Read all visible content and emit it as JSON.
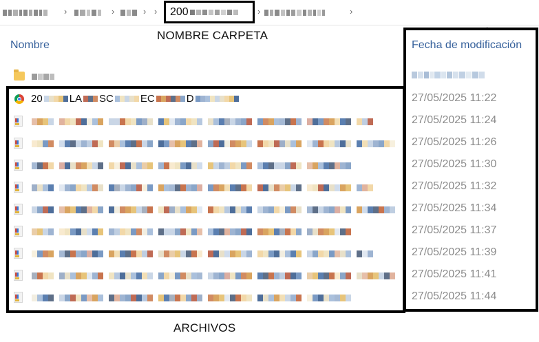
{
  "breadcrumb": {
    "current_folder_visible": "200"
  },
  "annotations": {
    "folder_name_label": "NOMBRE CARPETA",
    "files_label": "ARCHIVOS"
  },
  "columns": {
    "name_header": "Nombre",
    "modified_header": "Fecha de modificación",
    "sort_indicator": "^"
  },
  "folder_row": {
    "icon": "folder-icon"
  },
  "files": [
    {
      "icon": "chrome-icon",
      "name_fragments": [
        "20",
        "LA",
        "SC",
        "EC",
        "D"
      ],
      "modified": "27/05/2025 11:22"
    },
    {
      "icon": "file-icon",
      "modified": "27/05/2025 11:24"
    },
    {
      "icon": "file-icon",
      "modified": "27/05/2025 11:26"
    },
    {
      "icon": "file-icon",
      "modified": "27/05/2025 11:30"
    },
    {
      "icon": "file-icon",
      "modified": "27/05/2025 11:32"
    },
    {
      "icon": "file-icon",
      "modified": "27/05/2025 11:34"
    },
    {
      "icon": "file-icon",
      "modified": "27/05/2025 11:37"
    },
    {
      "icon": "file-icon",
      "modified": "27/05/2025 11:39"
    },
    {
      "icon": "file-icon",
      "modified": "27/05/2025 11:41"
    },
    {
      "icon": "file-icon",
      "modified": "27/05/2025 11:44"
    }
  ],
  "colors": {
    "annotation_box": "#000000",
    "header_text": "#35609b",
    "date_text": "#8c8c8c"
  }
}
